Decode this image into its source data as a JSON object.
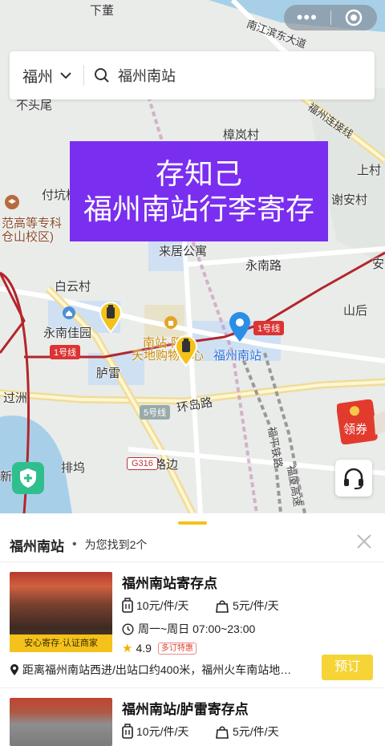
{
  "map": {
    "places": {
      "xiadong": "下董",
      "nanjiang_road": "南江滨东大道",
      "bu_tou_wei": "不头尾",
      "fuzhou_link_line": "福州连接线",
      "zhanglan_village": "樟岚村",
      "shangcun": "上村",
      "fukeng_bridge": "付坑桥",
      "xieancun": "谢安村",
      "college_line1": "范高等专科",
      "college_line2": "仓山校区)",
      "laiju_apartment": "来居公寓",
      "yongnan_road": "永南路",
      "an_edge": "安",
      "baiyun_village": "白云村",
      "shanhou": "山后",
      "yongnan_jiayuan": "永南佳园",
      "nanzhan_shopping": "南站·阳光",
      "tiandi_mall": "天地购物中心",
      "fuzhou_south_station_label": "福州南站",
      "luqi": "胪雷",
      "guozhou": "过洲",
      "huandao_road": "环岛路",
      "fuping_rail": "福平铁路",
      "fuxia_rail": "福厦高速",
      "paiwu": "排坞",
      "lubian": "路边",
      "xin": "新"
    },
    "route_tags": {
      "line1_a": "1号线",
      "line1_b": "1号线",
      "line5": "5号线",
      "g316": "G316"
    },
    "coupon_label": "领券"
  },
  "capsule": {
    "more_icon": "•••"
  },
  "search": {
    "city": "福州",
    "query": "福州南站"
  },
  "banner": {
    "line1": "存知己",
    "line2": "福州南站行李寄存"
  },
  "sheet": {
    "location": "福州南站",
    "dot": "•",
    "found_text": "为您找到2个"
  },
  "results": [
    {
      "title": "福州南站寄存点",
      "tag": "安心寄存·认证商家",
      "price_small": "10元/件/天",
      "price_large": "5元/件/天",
      "hours": "周一~周日 07:00~23:00",
      "rating": "4.9",
      "promo": "多订特惠",
      "address": "距离福州南站西进/出站口约400米，福州火车南站地…",
      "book_label": "预订"
    },
    {
      "title": "福州南站/胪雷寄存点",
      "price_small": "10元/件/天",
      "price_large": "5元/件/天"
    }
  ],
  "colors": {
    "accent_yellow": "#f4c21a",
    "banner_purple": "#7a2ef0",
    "station_blue": "#2b6fd6",
    "metro_red": "#d33"
  }
}
